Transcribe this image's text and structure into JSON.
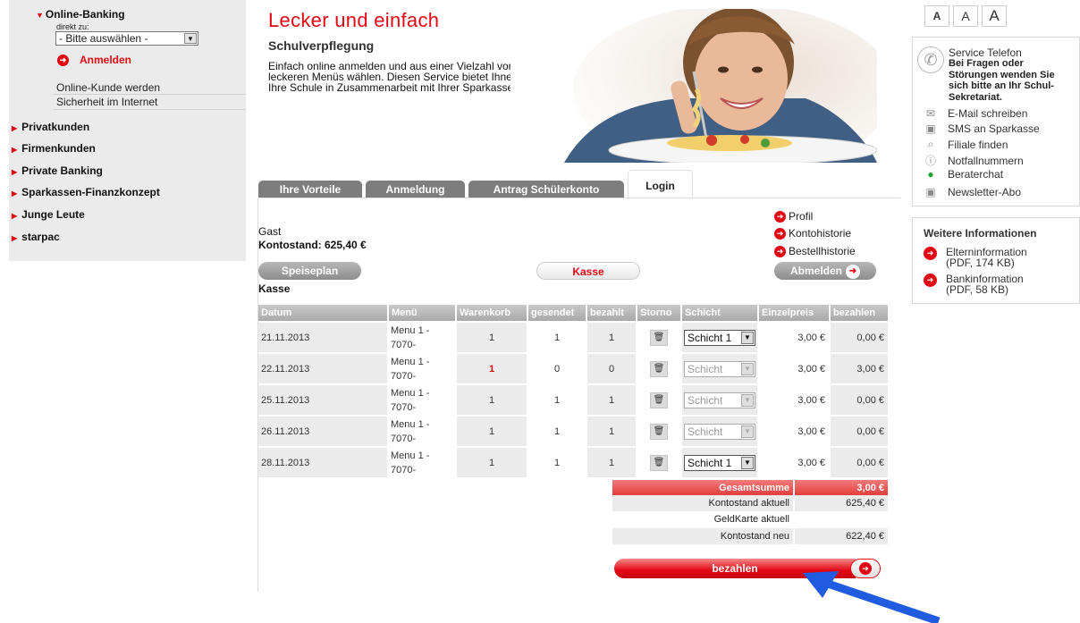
{
  "sidebar": {
    "online_banking": "Online-Banking",
    "direkt_label": "direkt zu:",
    "select_value": "- Bitte auswählen -",
    "anmelden": "Anmelden",
    "links": [
      "Online-Kunde werden",
      "Sicherheit im Internet"
    ],
    "nav": [
      "Privatkunden",
      "Firmenkunden",
      "Private Banking",
      "Sparkassen-Finanzkonzept",
      "Junge Leute",
      "starpac"
    ]
  },
  "hero": {
    "title": "Lecker und einfach",
    "subtitle": "Schulverpflegung",
    "text": "Einfach online anmelden und aus einer Vielzahl von leckeren Menüs wählen. Diesen Service bietet Ihnen Ihre Schule in Zusammenarbeit mit Ihrer Sparkasse."
  },
  "tabs": [
    "Ihre Vorteile",
    "Anmeldung",
    "Antrag Schülerkonto",
    "Login"
  ],
  "active_tab": "Login",
  "account": {
    "user": "Gast",
    "balance": "Kontostand: 625,40 €",
    "links": [
      "Profil",
      "Kontohistorie",
      "Bestellhistorie"
    ]
  },
  "buttons": {
    "speiseplan": "Speiseplan",
    "kasse": "Kasse",
    "abmelden": "Abmelden",
    "bezahlen": "bezahlen"
  },
  "section_title": "Kasse",
  "table": {
    "headers": [
      "Datum",
      "Menü",
      "Warenkorb",
      "gesendet",
      "bezahlt",
      "Storno",
      "Schicht",
      "Einzelpreis",
      "bezahlen"
    ],
    "rows": [
      {
        "datum": "21.11.2013",
        "menu1": "Menu 1 -",
        "menu2": "7070-",
        "warenkorb": "1",
        "gesendet": "1",
        "bezahlt": "1",
        "schicht": "Schicht 1",
        "schicht_enabled": true,
        "preis": "3,00 €",
        "bezahlen": "0,00 €"
      },
      {
        "datum": "22.11.2013",
        "menu1": "Menu 1 -",
        "menu2": "7070-",
        "warenkorb": "1",
        "gesendet": "0",
        "bezahlt": "0",
        "schicht": "Schicht",
        "schicht_enabled": false,
        "preis": "3,00 €",
        "bezahlen": "3,00 €"
      },
      {
        "datum": "25.11.2013",
        "menu1": "Menu 1 -",
        "menu2": "7070-",
        "warenkorb": "1",
        "gesendet": "1",
        "bezahlt": "1",
        "schicht": "Schicht",
        "schicht_enabled": false,
        "preis": "3,00 €",
        "bezahlen": "0,00 €"
      },
      {
        "datum": "26.11.2013",
        "menu1": "Menu 1 -",
        "menu2": "7070-",
        "warenkorb": "1",
        "gesendet": "1",
        "bezahlt": "1",
        "schicht": "Schicht",
        "schicht_enabled": false,
        "preis": "3,00 €",
        "bezahlen": "0,00 €"
      },
      {
        "datum": "28.11.2013",
        "menu1": "Menu 1 -",
        "menu2": "7070-",
        "warenkorb": "1",
        "gesendet": "1",
        "bezahlt": "1",
        "schicht": "Schicht 1",
        "schicht_enabled": true,
        "preis": "3,00 €",
        "bezahlen": "0,00 €"
      }
    ]
  },
  "totals": {
    "gesamtsumme_label": "Gesamtsumme",
    "gesamtsumme_value": "3,00 €",
    "kontostand_aktuell_label": "Kontostand aktuell",
    "kontostand_aktuell_value": "625,40 €",
    "geldkarte_label": "GeldKarte aktuell",
    "geldkarte_value": "",
    "kontostand_neu_label": "Kontostand neu",
    "kontostand_neu_value": "622,40 €"
  },
  "right": {
    "font_sizes": [
      "A",
      "A",
      "A"
    ],
    "service_title": "Service Telefon",
    "service_text": "Bei Fragen oder Störungen wenden Sie sich bitte an Ihr Schul-Sekretariat.",
    "service_links": [
      {
        "label": "E-Mail schreiben",
        "icon": "mail-icon"
      },
      {
        "label": "SMS an Sparkasse",
        "icon": "sms-icon"
      },
      {
        "label": "Filiale finden",
        "icon": "search-icon"
      },
      {
        "label": "Notfallnummern",
        "icon": "alert-icon"
      },
      {
        "label": "Beraterchat",
        "icon": "person-icon"
      },
      {
        "label": "Newsletter-Abo",
        "icon": "newsletter-icon"
      }
    ],
    "weitere_title": "Weitere Informationen",
    "weitere_links": [
      {
        "line1": "Elterninformation",
        "line2": "(PDF, 174 KB)"
      },
      {
        "line1": "Bankinformation",
        "line2": "(PDF, 58 KB)"
      }
    ]
  },
  "colors": {
    "brand_red": "#e30613",
    "annotation_blue": "#1f5ce0"
  }
}
